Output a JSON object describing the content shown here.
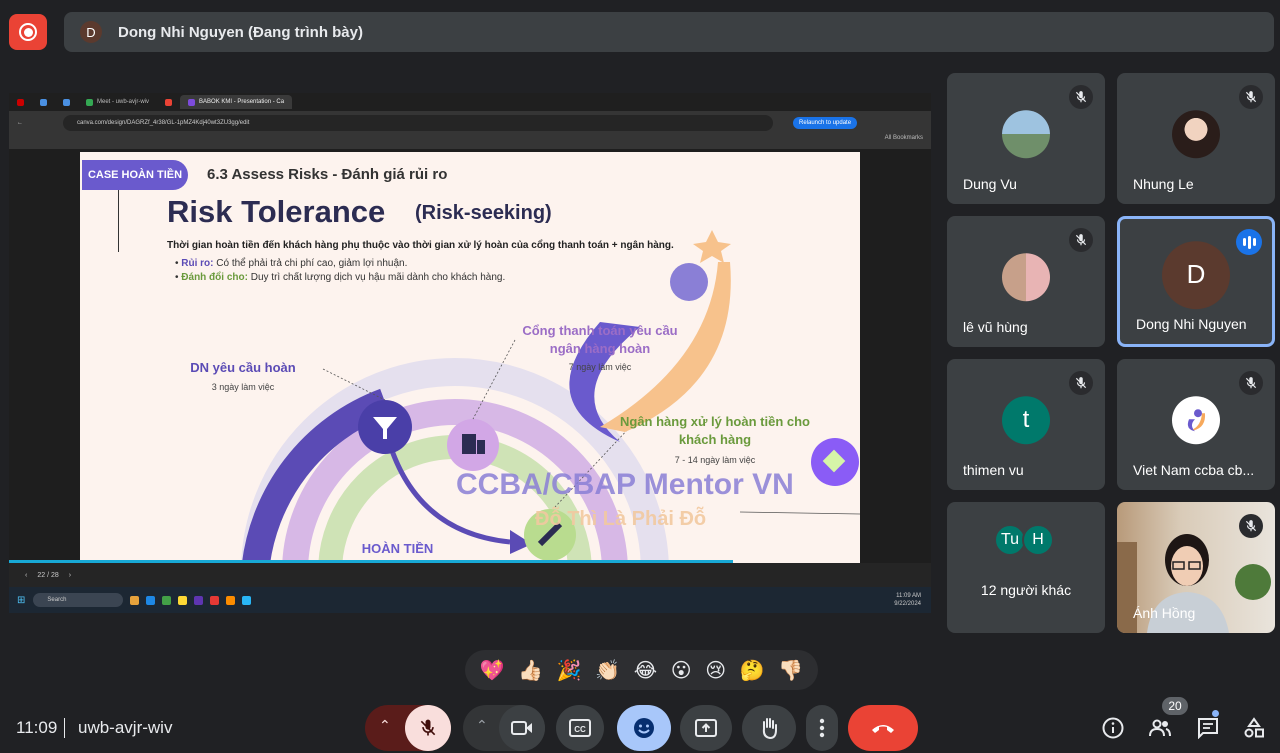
{
  "presenter": {
    "avatar_letter": "D",
    "name": "Dong Nhi Nguyen (Đang trình bày)"
  },
  "browser": {
    "tabs": [
      "Meet - uwb-avjr-wiv",
      "BABOK KMI - Presentation - Ca"
    ],
    "url": "canva.com/design/DAGRZf_4r38/GL-1pMZ4Kdj40wt3ZU3gg/edit",
    "relaunch": "Relaunch to update",
    "bookmarks": "All Bookmarks"
  },
  "slide": {
    "badge": "CASE HOÀN TIỀN",
    "section": "6.3 Assess Risks - Đánh giá rủi ro",
    "title": "Risk Tolerance",
    "subtitle": "(Risk-seeking)",
    "description": "Thời gian hoàn tiền đến khách hàng phụ thuộc vào thời gian xử lý hoàn của cổng thanh toán + ngân hàng.",
    "risk_key": "Rủi ro:",
    "risk_text": "Có thể phải trả chi phí cao, giảm lợi nhuận.",
    "trade_key": "Đánh đổi cho:",
    "trade_text": "Duy trì chất lượng dịch vụ hậu mãi dành cho khách hàng.",
    "step1_title": "DN yêu cầu hoàn",
    "step1_time": "3 ngày làm việc",
    "step2_title": "Cổng thanh toán yêu cầu ngân hàng hoàn",
    "step2_time": "7 ngày làm việc",
    "step3_title": "Ngân hàng xử lý hoàn tiền cho khách hàng",
    "step3_time": "7 - 14 ngày làm việc",
    "watermark1": "CCBA/CBAP Mentor VN",
    "watermark2": "Đỗ Thì Là Phải Đỗ",
    "bottom_label": "HOÀN TIỀN NHANH",
    "page": "22 / 28"
  },
  "taskbar": {
    "search": "Search",
    "time": "11:09 AM",
    "date": "9/22/2024"
  },
  "participants": [
    {
      "name": "Dung Vu",
      "muted": true
    },
    {
      "name": "Nhung Le",
      "muted": true
    },
    {
      "name": "lê vũ hùng",
      "muted": true
    },
    {
      "name": "Dong Nhi Nguyen",
      "avatar_letter": "D",
      "speaking": true
    },
    {
      "name": "thimen vu",
      "avatar_letter": "t",
      "muted": true
    },
    {
      "name": "Viet Nam ccba cb...",
      "muted": true
    },
    {
      "name": "12 người khác",
      "avatars": [
        "Tu",
        "H"
      ]
    },
    {
      "name": "Ánh Hồng",
      "muted": true
    }
  ],
  "reactions": [
    "💖",
    "👍🏻",
    "🎉",
    "👏🏻",
    "😂",
    "😮",
    "😢",
    "🤔",
    "👎🏻"
  ],
  "bottom": {
    "time": "11:09",
    "meeting_code": "uwb-avjr-wiv",
    "people_count": "20"
  },
  "colors": {
    "accent": "#8ab4f8",
    "end_call": "#ea4335",
    "mic_off_bg": "#f9dedc",
    "emoji_active": "#a8c7fa"
  }
}
